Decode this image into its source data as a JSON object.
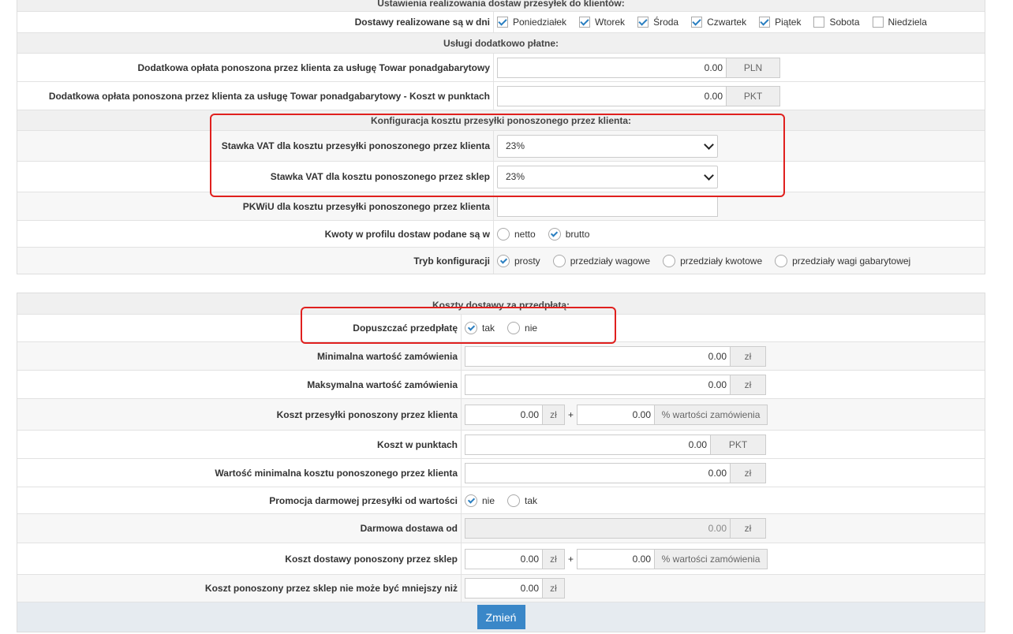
{
  "section1": {
    "title": "Ustawienia realizowania dostaw przesyłek do klientów:",
    "days_label": "Dostawy realizowane są w dni",
    "days": [
      {
        "label": "Poniedziałek",
        "checked": true
      },
      {
        "label": "Wtorek",
        "checked": true
      },
      {
        "label": "Środa",
        "checked": true
      },
      {
        "label": "Czwartek",
        "checked": true
      },
      {
        "label": "Piątek",
        "checked": true
      },
      {
        "label": "Sobota",
        "checked": false
      },
      {
        "label": "Niedziela",
        "checked": false
      }
    ],
    "extra_title": "Usługi dodatkowo płatne:",
    "oversize_label": "Dodatkowa opłata ponoszona przez klienta za usługę Towar ponadgabarytowy",
    "oversize_value": "0.00",
    "oversize_unit": "PLN",
    "oversize_points_label": "Dodatkowa opłata ponoszona przez klienta za usługę Towar ponadgabarytowy - Koszt w punktach",
    "oversize_points_value": "0.00",
    "oversize_points_unit": "PKT",
    "config_title": "Konfiguracja kosztu przesyłki ponoszonego przez klienta:",
    "vat_client_label": "Stawka VAT dla kosztu przesyłki ponoszonego przez klienta",
    "vat_client_value": "23%",
    "vat_shop_label": "Stawka VAT dla kosztu ponoszonego przez sklep",
    "vat_shop_value": "23%",
    "pkwiu_label": "PKWiU dla kosztu przesyłki ponoszonego przez klienta",
    "pkwiu_value": "",
    "amounts_label": "Kwoty w profilu dostaw podane są w",
    "amounts_options": [
      {
        "label": "netto",
        "checked": false
      },
      {
        "label": "brutto",
        "checked": true
      }
    ],
    "mode_label": "Tryb konfiguracji",
    "mode_options": [
      {
        "label": "prosty",
        "checked": true
      },
      {
        "label": "przedziały wagowe",
        "checked": false
      },
      {
        "label": "przedziały kwotowe",
        "checked": false
      },
      {
        "label": "przedziały wagi gabarytowej",
        "checked": false
      }
    ]
  },
  "section2": {
    "title": "Koszty dostawy za przedpłatą:",
    "prepay_label": "Dopuszczać przedpłatę",
    "prepay_options": [
      {
        "label": "tak",
        "checked": true
      },
      {
        "label": "nie",
        "checked": false
      }
    ],
    "min_label": "Minimalna wartość zamówienia",
    "min_value": "0.00",
    "min_unit": "zł",
    "max_label": "Maksymalna wartość zamówienia",
    "max_value": "0.00",
    "max_unit": "zł",
    "client_cost_label": "Koszt przesyłki ponoszony przez klienta",
    "client_cost_value": "0.00",
    "client_cost_unit": "zł",
    "plus": "+",
    "client_cost_pct_value": "0.00",
    "client_cost_pct_unit": "% wartości zamówienia",
    "points_label": "Koszt w punktach",
    "points_value": "0.00",
    "points_unit": "PKT",
    "min_client_label": "Wartość minimalna kosztu ponoszonego przez klienta",
    "min_client_value": "0.00",
    "min_client_unit": "zł",
    "promo_label": "Promocja darmowej przesyłki od wartości",
    "promo_options": [
      {
        "label": "nie",
        "checked": true
      },
      {
        "label": "tak",
        "checked": false
      }
    ],
    "free_label": "Darmowa dostawa od",
    "free_value": "0.00",
    "free_unit": "zł",
    "shop_cost_label": "Koszt dostawy ponoszony przez sklep",
    "shop_cost_value": "0.00",
    "shop_cost_unit": "zł",
    "shop_cost_pct_value": "0.00",
    "shop_cost_pct_unit": "% wartości zamówienia",
    "shop_min_label": "Koszt ponoszony przez sklep nie może być mniejszy niż",
    "shop_min_value": "0.00",
    "shop_min_unit": "zł",
    "submit_label": "Zmień"
  }
}
